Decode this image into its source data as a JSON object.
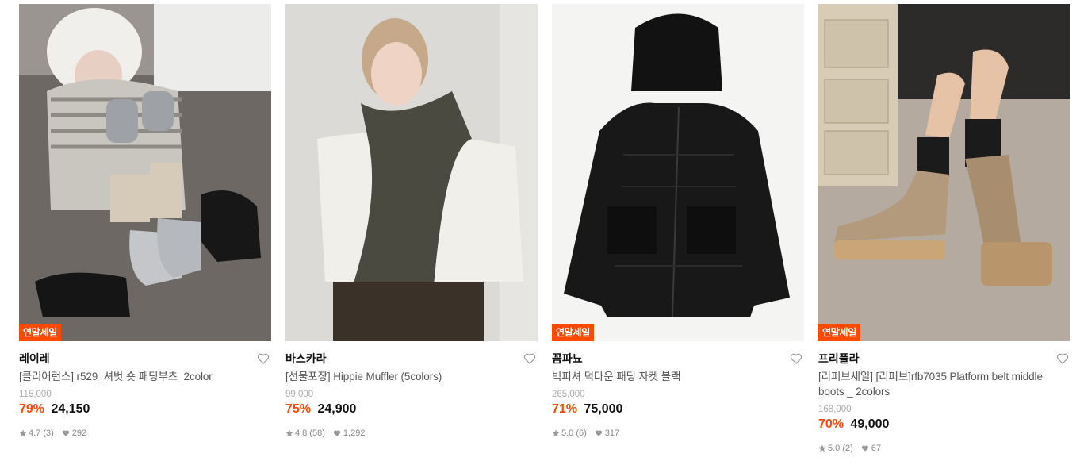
{
  "colors": {
    "accent": "#ff4800",
    "badge_bg": "#ff4800",
    "text": "#111111",
    "muted": "#888888"
  },
  "products": [
    {
      "badge": "연말세일",
      "brand": "레이레",
      "name": "[클리어런스] r529_셔벗 숏 패딩부츠_2color",
      "original_price": "115,000",
      "discount": "79%",
      "price": "24,150",
      "rating": "4.7 (3)",
      "likes": "292",
      "image_icon": "padded-boots-photo"
    },
    {
      "badge": "",
      "brand": "바스카라",
      "name": "[선물포장] Hippie Muffler (5colors)",
      "original_price": "99,000",
      "discount": "75%",
      "price": "24,900",
      "rating": "4.8 (58)",
      "likes": "1,292",
      "image_icon": "scarf-model-photo"
    },
    {
      "badge": "연말세일",
      "brand": "꼼파뇨",
      "name": "빅피셔 덕다운 패딩 자켓 블랙",
      "original_price": "265,000",
      "discount": "71%",
      "price": "75,000",
      "rating": "5.0 (6)",
      "likes": "317",
      "image_icon": "black-puffer-jacket-photo"
    },
    {
      "badge": "연말세일",
      "brand": "프리플라",
      "name": "[리퍼브세일] [리퍼브]rfb7035 Platform belt middle boots _ 2colors",
      "original_price": "168,000",
      "discount": "70%",
      "price": "49,000",
      "rating": "5.0 (2)",
      "likes": "67",
      "image_icon": "platform-boots-photo"
    }
  ]
}
